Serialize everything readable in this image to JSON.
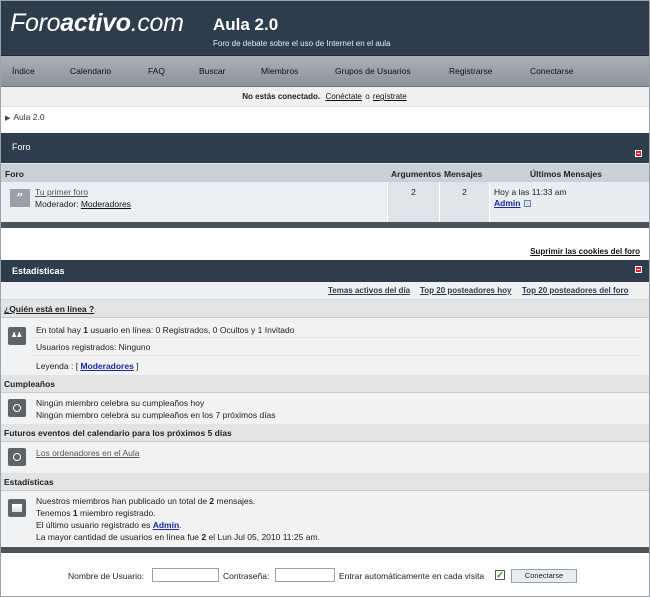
{
  "header": {
    "logo_part1": "Foro",
    "logo_part2": "activo",
    "logo_part3": ".com",
    "site_title": "Aula 2.0",
    "site_description": "Foro de debate sobre el uso de Internet en el aula"
  },
  "nav": {
    "items": [
      "Índice",
      "Calendario",
      "FAQ",
      "Buscar",
      "Miembros",
      "Grupos de Usuarios",
      "Registrarse",
      "Conectarse"
    ]
  },
  "login_bar": {
    "status": "No estás conectado.",
    "login_link": "Conéctate",
    "or": "o",
    "register_link": "regístrate"
  },
  "breadcrumb": "Aula 2.0",
  "forum_panel": {
    "title": "Foro",
    "columns": [
      "Foro",
      "Argumentos",
      "Mensajes",
      "Últimos Mensajes"
    ],
    "row": {
      "forum_name": "Tu primer foro",
      "moderator_label": "Moderador:",
      "moderator_link": "Moderadores",
      "topics": "2",
      "posts": "2",
      "last_time": "Hoy a las 11:33 am",
      "last_user": "Admin"
    }
  },
  "cookie_link": "Suprimir las cookies del foro",
  "stats_panel": {
    "title": "Estadísticas",
    "links": [
      "Temas activos del día",
      "Top 20 posteadores hoy",
      "Top 20 posteadores del foro"
    ],
    "who_online": {
      "heading": "¿Quién está en línea ?",
      "text_pre": "En total hay",
      "count": "1",
      "text_post": "usuario en línea: 0 Registrados, 0 Ocultos y 1 Invitado",
      "registered": "Usuarios registrados: Ninguno",
      "legend_label": "Leyenda : [",
      "legend_link": "Moderadores",
      "legend_end": "]"
    },
    "birthdays": {
      "heading": "Cumpleaños",
      "line1": "Ningún miembro celebra su cumpleaños hoy",
      "line2": "Ningún miembro celebra su cumpleaños en los 7 próximos días"
    },
    "events": {
      "heading": "Futuros eventos del calendario para los próximos 5 días",
      "item": "Los ordenadores en el Aula"
    },
    "statistics": {
      "heading": "Estadísticas",
      "line1_pre": "Nuestros miembros han publicado un total de",
      "line1_num": "2",
      "line1_post": "mensajes.",
      "line2_pre": "Tenemos",
      "line2_num": "1",
      "line2_post": "miembro registrado.",
      "line3_pre": "El último usuario registrado es",
      "line3_link": "Admin",
      "line3_post": ".",
      "line4_pre": "La mayor cantidad de usuarios en línea fue",
      "line4_num": "2",
      "line4_post": "el Lun Jul 05, 2010 11:25 am."
    }
  },
  "bottom_login": {
    "username_label": "Nombre de Usuario:",
    "password_label": "Contraseña:",
    "auto_login_label": "Entrar automáticamente en cada visita",
    "button": "Conectarse"
  }
}
